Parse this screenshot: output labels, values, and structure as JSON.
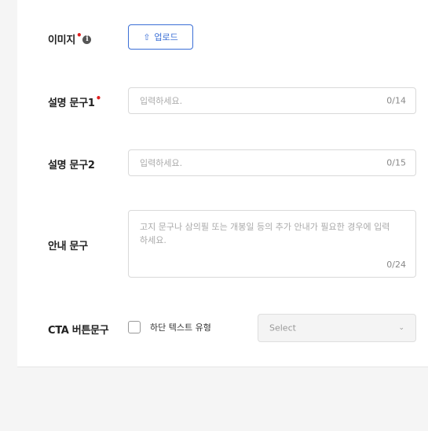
{
  "form": {
    "image": {
      "label": "이미지",
      "required_mark": "•",
      "info_icon": "info-icon",
      "upload_icon": "upload-icon",
      "upload_label": "업로드"
    },
    "desc1": {
      "label": "설명 문구1",
      "required_mark": "•",
      "placeholder": "입력하세요.",
      "counter": "0/14"
    },
    "desc2": {
      "label": "설명 문구2",
      "placeholder": "입력하세요.",
      "counter": "0/15"
    },
    "notice": {
      "label": "안내 문구",
      "placeholder": "고지 문구나 삼의필 또는 개봉일 등의 추가 안내가 필요한 경우에 입력하세요.",
      "counter": "0/24"
    },
    "cta": {
      "label": "CTA 버튼문구",
      "checkbox_label": "하단 텍스트 유형",
      "checked": false,
      "select_value": "Select",
      "select_icon": "chevron-down-icon"
    }
  },
  "colors": {
    "accent": "#3b6fd6",
    "required": "#e02020"
  }
}
